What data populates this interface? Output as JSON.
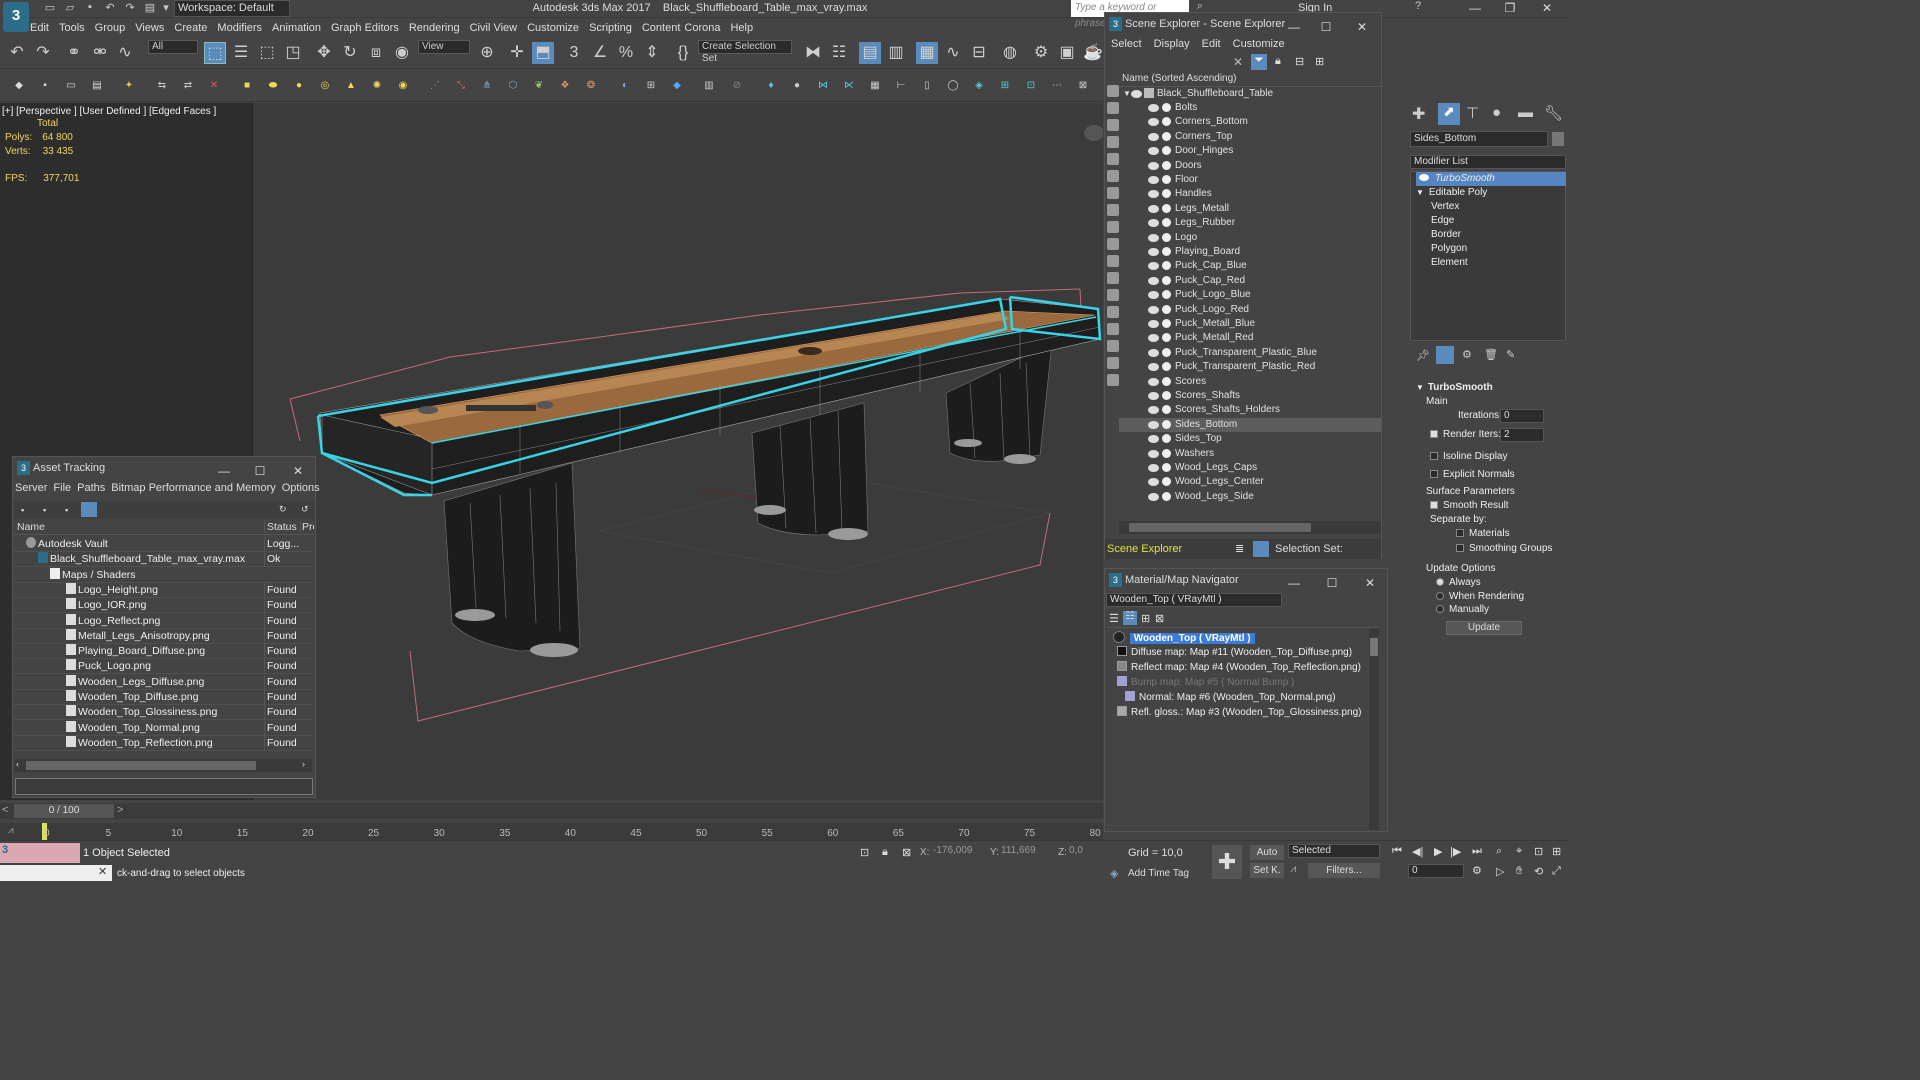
{
  "app": {
    "logo": "3",
    "title": "Autodesk 3ds Max 2017",
    "filename": "Black_Shuffleboard_Table_max_vray.max",
    "workspace": "Workspace: Default",
    "search_placeholder": "Type a keyword or phrase",
    "sign_in": "Sign In"
  },
  "menu": [
    "Edit",
    "Tools",
    "Group",
    "Views",
    "Create",
    "Modifiers",
    "Animation",
    "Graph Editors",
    "Rendering",
    "Civil View",
    "Customize",
    "Scripting",
    "Content",
    "Corona",
    "Help"
  ],
  "toolbar": {
    "filter_select": "All",
    "view_select": "View",
    "create_selection_set": "Create Selection Set"
  },
  "viewport": {
    "label": "[+] [Perspective ]  [User Defined ]  [Edged Faces ]",
    "stats_total": "Total",
    "polys_label": "Polys:",
    "polys": "64 800",
    "verts_label": "Verts:",
    "verts": "33 435",
    "fps_label": "FPS:",
    "fps": "377,701"
  },
  "scene_explorer": {
    "title": "Scene Explorer - Scene Explorer",
    "menu": [
      "Select",
      "Display",
      "Edit",
      "Customize"
    ],
    "column": "Name (Sorted Ascending)",
    "root": "Black_Shuffleboard_Table",
    "items": [
      "Bolts",
      "Corners_Bottom",
      "Corners_Top",
      "Door_Hinges",
      "Doors",
      "Floor",
      "Handles",
      "Legs_Metall",
      "Legs_Rubber",
      "Logo",
      "Playing_Board",
      "Puck_Cap_Blue",
      "Puck_Cap_Red",
      "Puck_Logo_Blue",
      "Puck_Logo_Red",
      "Puck_Metall_Blue",
      "Puck_Metall_Red",
      "Puck_Transparent_Plastic_Blue",
      "Puck_Transparent_Plastic_Red",
      "Scores",
      "Scores_Shafts",
      "Scores_Shafts_Holders",
      "Sides_Bottom",
      "Sides_Top",
      "Washers",
      "Wood_Legs_Caps",
      "Wood_Legs_Center",
      "Wood_Legs_Side"
    ],
    "selected": "Sides_Bottom",
    "footer_label": "Scene Explorer",
    "selection_set_label": "Selection Set:"
  },
  "command_panel": {
    "object_name": "Sides_Bottom",
    "modifier_list": "Modifier List",
    "stack": [
      "TurboSmooth",
      "Editable Poly",
      "Vertex",
      "Edge",
      "Border",
      "Polygon",
      "Element"
    ],
    "rollout_title": "TurboSmooth",
    "main_label": "Main",
    "iterations_label": "Iterations:",
    "iterations": "0",
    "render_iters_label": "Render Iters:",
    "render_iters": "2",
    "isoline": "Isoline Display",
    "explicit_normals": "Explicit Normals",
    "surface_params": "Surface Parameters",
    "smooth_result": "Smooth Result",
    "separate_by": "Separate by:",
    "materials": "Materials",
    "smoothing_groups": "Smoothing Groups",
    "update_options": "Update Options",
    "always": "Always",
    "when_rendering": "When Rendering",
    "manually": "Manually",
    "update_btn": "Update"
  },
  "asset_tracking": {
    "title": "Asset Tracking",
    "menu": [
      "Server",
      "File",
      "Paths",
      "Bitmap Performance and Memory",
      "Options"
    ],
    "columns": [
      "Name",
      "Status",
      "Pro"
    ],
    "rows": [
      {
        "name": "Autodesk Vault",
        "status": "Logg..."
      },
      {
        "name": "Black_Shuffleboard_Table_max_vray.max",
        "status": "Ok"
      },
      {
        "name": "Maps / Shaders",
        "status": ""
      },
      {
        "name": "Logo_Height.png",
        "status": "Found"
      },
      {
        "name": "Logo_IOR.png",
        "status": "Found"
      },
      {
        "name": "Logo_Reflect.png",
        "status": "Found"
      },
      {
        "name": "Metall_Legs_Anisotropy.png",
        "status": "Found"
      },
      {
        "name": "Playing_Board_Diffuse.png",
        "status": "Found"
      },
      {
        "name": "Puck_Logo.png",
        "status": "Found"
      },
      {
        "name": "Wooden_Legs_Diffuse.png",
        "status": "Found"
      },
      {
        "name": "Wooden_Top_Diffuse.png",
        "status": "Found"
      },
      {
        "name": "Wooden_Top_Glossiness.png",
        "status": "Found"
      },
      {
        "name": "Wooden_Top_Normal.png",
        "status": "Found"
      },
      {
        "name": "Wooden_Top_Reflection.png",
        "status": "Found"
      }
    ]
  },
  "material_navigator": {
    "title": "Material/Map Navigator",
    "current": "Wooden_Top  ( VRayMtl )",
    "root": "Wooden_Top  ( VRayMtl )",
    "items": [
      "Diffuse map: Map #11 (Wooden_Top_Diffuse.png)",
      "Reflect map: Map #4 (Wooden_Top_Reflection.png)",
      "Bump map: Map #5  ( Normal Bump )",
      "Normal: Map #6 (Wooden_Top_Normal.png)",
      "Refl. gloss.: Map #3 (Wooden_Top_Glossiness.png)"
    ]
  },
  "timeline": {
    "frame": "0 / 100",
    "ticks": [
      "0",
      "5",
      "10",
      "15",
      "20",
      "25",
      "30",
      "35",
      "40",
      "45",
      "50",
      "55",
      "60",
      "65",
      "70",
      "75",
      "80"
    ]
  },
  "status": {
    "selected": "1 Object Selected",
    "hint": "ck-and-drag to select objects",
    "x_label": "X:",
    "x": "-176,009",
    "y_label": "Y:",
    "y": "111,669",
    "z_label": "Z:",
    "z": "0,0",
    "grid": "Grid = 10,0",
    "add_time_tag": "Add Time Tag",
    "auto": "Auto",
    "selected_dd": "Selected",
    "setk": "Set K.",
    "filters": "Filters...",
    "frame_field": "0"
  }
}
